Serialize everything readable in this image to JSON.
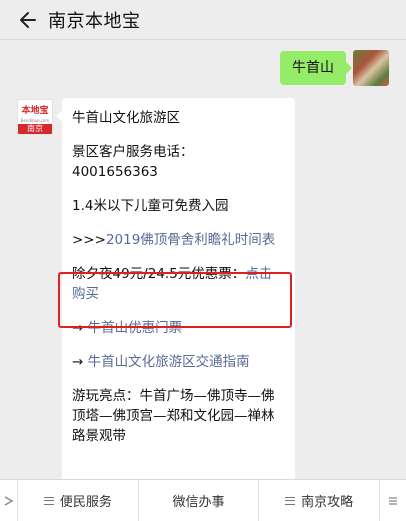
{
  "header": {
    "title": "南京本地宝"
  },
  "chat": {
    "sent_message": "牛首山",
    "bot_avatar": {
      "logo_text": "本地宝",
      "logo_url_text": "Bendibao.com",
      "city": "南京"
    },
    "reply": {
      "line1": "牛首山文化旅游区",
      "phone_label": "景区客户服务电话：",
      "phone_number": "4001656363",
      "children_free": "1.4米以下儿童可免费入园",
      "relic_prefix": ">>>",
      "relic_link": "2019佛顶骨舍利瞻礼时间表",
      "ticket_text": "除夕夜49元/24.5元优惠票：",
      "ticket_link": "点击购买",
      "discount_arrow": "→ ",
      "discount_link": "牛首山优惠门票",
      "traffic_arrow": "→ ",
      "traffic_link": "牛首山文化旅游区交通指南",
      "highlights": "游玩亮点：牛首广场—佛顶寺—佛顶塔—佛顶宫—郑和文化园—禅林路景观带"
    }
  },
  "bottom_menu": {
    "items": [
      "便民服务",
      "微信办事",
      "南京攻略"
    ]
  }
}
